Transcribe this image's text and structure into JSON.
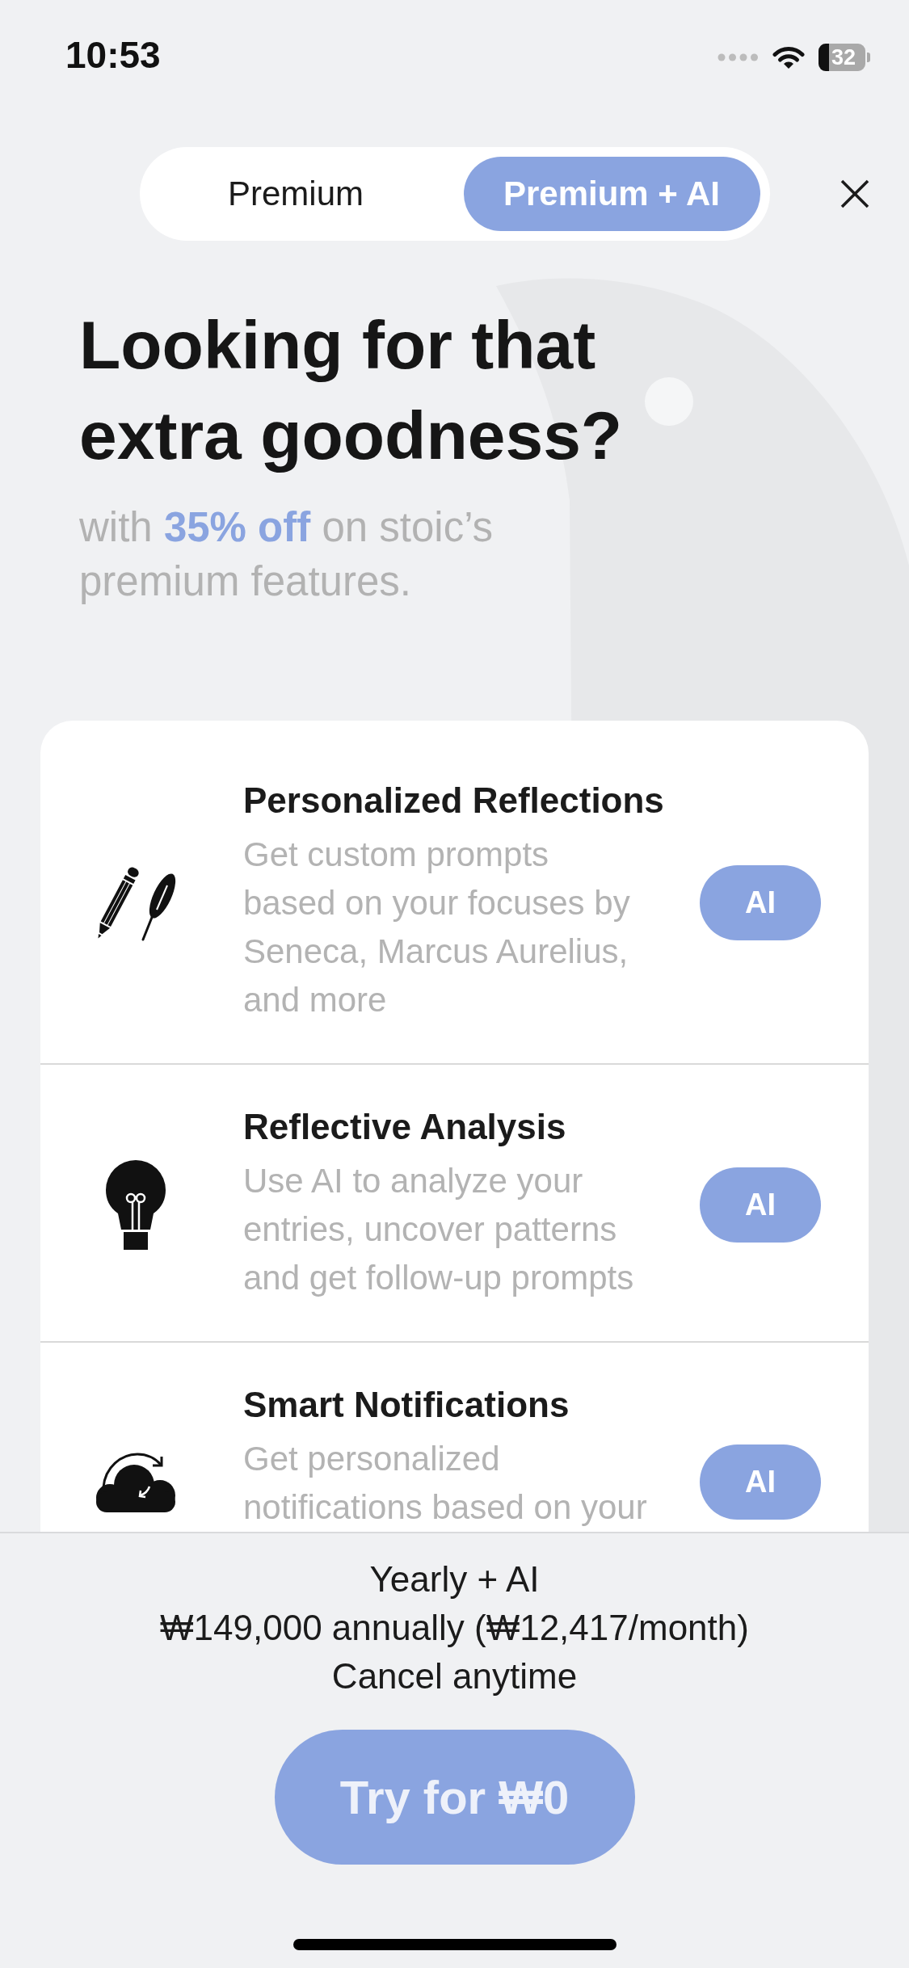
{
  "status_bar": {
    "time": "10:53",
    "battery": "32"
  },
  "plan_tabs": [
    {
      "label": "Premium",
      "selected": false
    },
    {
      "label": "Premium + AI",
      "selected": true
    }
  ],
  "headline": "Looking for that\nextra goodness?",
  "subtitle": "with **35% off** on stoic’s\npremium features.",
  "features": [
    {
      "title": "Personalized Reflections",
      "description": "Get custom prompts\nbased on your focuses by\nSeneca, Marcus Aurelius,\nand more",
      "badge": "AI"
    },
    {
      "title": "Reflective Analysis",
      "description": "Use AI to analyze your\nentries, uncover patterns\nand get follow-up prompts",
      "badge": "AI"
    },
    {
      "title": "Smart Notifications",
      "description": "Get personalized\nnotifications based on your",
      "badge": "AI"
    }
  ],
  "plan_summary": {
    "name": "Yearly + AI",
    "price": "₩149,000 annually (₩12,417/month)",
    "note": "Cancel anytime"
  },
  "cta_button": "Try for ₩0"
}
